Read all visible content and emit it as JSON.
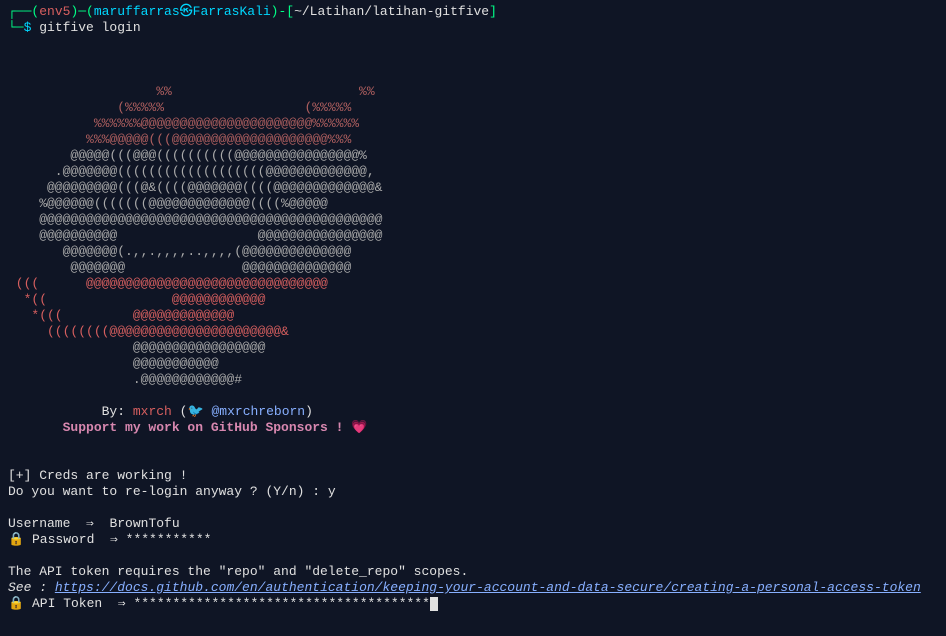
{
  "prompt": {
    "env": "env5",
    "userhost": "maruffarras㉿FarrasKali",
    "path": "~/Latihan/latihan-gitfive",
    "command": "gitfive login"
  },
  "ascii": {
    "l01": "                   %%                        %%",
    "l02": "              (%%%%%                  (%%%%%",
    "l03": "           %%%%%%@@@@@@@@@@@@@@@@@@@@@@%%%%%%",
    "l04": "          %%%@@@@@(((@@@@@@@@@@@@@@@@@@@@%%%",
    "l05": "        @@@@@(((@@@((((((((((@@@@@@@@@@@@@@@@%    ",
    "l06": "      .@@@@@@@(((((((((((((((((((@@@@@@@@@@@@@,",
    "l07": "     @@@@@@@@@(((@&((((@@@@@@@((((@@@@@@@@@@@@@&",
    "l08": "    %@@@@@@(((((((@@@@@@@@@@@@@((((%@@@@@",
    "l09": "    @@@@@@@@@@@@@@@@@@@@@@@@@@@@@@@@@@@@@@@@@@@@",
    "l10": "    @@@@@@@@@@                  @@@@@@@@@@@@@@@@",
    "l11": "       @@@@@@@(.,,.,,,,..,,,,(@@@@@@@@@@@@@@",
    "l12": "        @@@@@@@               @@@@@@@@@@@@@@",
    "l13": " (((      @@@@@@@@@@@@@@@@@@@@@@@@@@@@@@@",
    "l14": "  *((                @@@@@@@@@@@@",
    "l15": "   *(((         @@@@@@@@@@@@@",
    "l16": "     ((((((((@@@@@@@@@@@@@@@@@@@@@@&",
    "l17": "                @@@@@@@@@@@@@@@@@",
    "l18": "                @@@@@@@@@@@",
    "l19": "                .@@@@@@@@@@@@#"
  },
  "by_label": "By:",
  "author": "mxrch",
  "author_handle": "@mxrchreborn",
  "support": "Support my work on GitHub Sponsors !",
  "output": {
    "creds": "[+] Creds are working !",
    "relogin": "Do you want to re-login anyway ? (Y/n) : y",
    "user_label": "Username  ⇒",
    "user_val": "BrownTofu",
    "pass_label": " Password  ⇒",
    "pass_val": "***********",
    "scopes": "The API token requires the \"repo\" and \"delete_repo\" scopes.",
    "see": "See :",
    "see_url": "https://docs.github.com/en/authentication/keeping-your-account-and-data-secure/creating-a-personal-access-token",
    "token_label": " API Token  ⇒",
    "token_val": "**************************************"
  }
}
